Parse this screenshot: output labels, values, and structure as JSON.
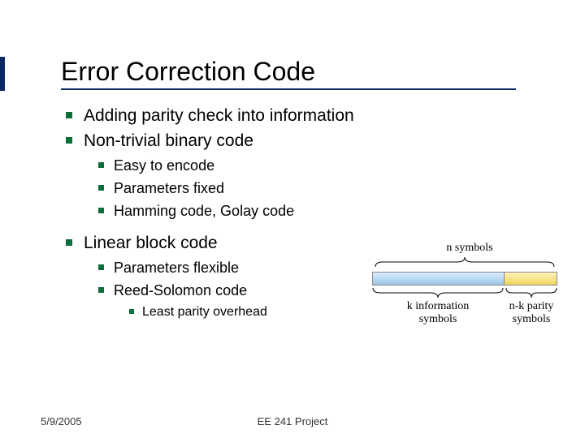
{
  "title": "Error Correction Code",
  "bullets": {
    "b1": "Adding parity check into information",
    "b2": "Non-trivial binary code",
    "b2_1": "Easy to encode",
    "b2_2": "Parameters fixed",
    "b2_3": "Hamming code, Golay code",
    "b3": "Linear block code",
    "b3_1": "Parameters flexible",
    "b3_2": "Reed-Solomon code",
    "b3_2_1": "Least parity overhead"
  },
  "diagram": {
    "n_label": "n symbols",
    "k_label": "k information\nsymbols",
    "nk_label": "n-k parity\nsymbols"
  },
  "footer": {
    "date": "5/9/2005",
    "center": "EE 241 Project"
  }
}
